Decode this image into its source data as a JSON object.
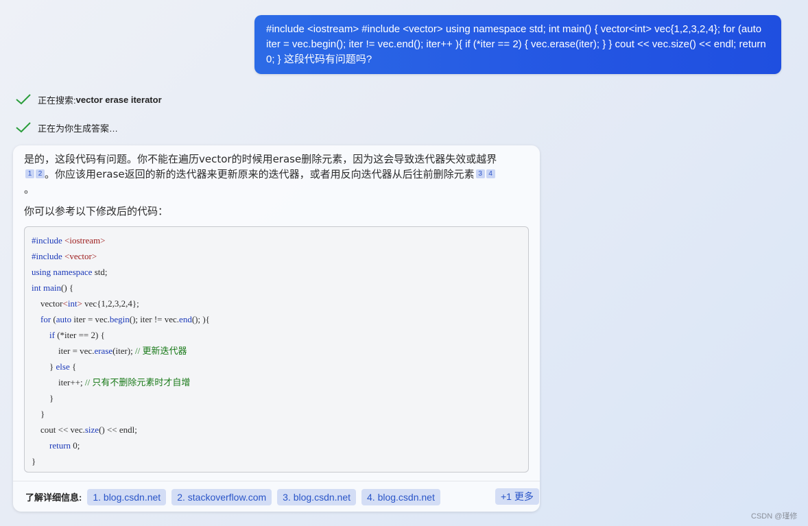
{
  "user_message": "#include <iostream> #include <vector> using namespace std; int main() { vector<int> vec{1,2,3,2,4}; for (auto iter = vec.begin(); iter != vec.end(); iter++ ){ if (*iter == 2) { vec.erase(iter); } } cout << vec.size() << endl; return 0; } 这段代码有问题吗?",
  "status": [
    {
      "prefix": "正在搜索: ",
      "bold": "vector erase iterator"
    },
    {
      "prefix": "正在为你生成答案…",
      "bold": ""
    }
  ],
  "answer": {
    "para1_a": "是的，这段代码有问题。你不能在遍历vector的时候用erase删除元素，因为这会导致迭代器失效或越界",
    "para1_b": "。你应该用erase返回的新的迭代器来更新原来的迭代器，或者用反向迭代器从后往前删除元素",
    "para1_c": "。",
    "cites": [
      "1",
      "2",
      "3",
      "4"
    ],
    "para2": "你可以参考以下修改后的代码："
  },
  "code": {
    "l1_pp": "#include",
    "l1_str": "<iostream>",
    "l2_pp": "#include",
    "l2_str": "<vector>",
    "l3_kw1": "using",
    "l3_kw2": "namespace",
    "l3_rest": " std;",
    "l4_kw": "int",
    "l4_fn": "main",
    "l4_rest": "() {",
    "l5_a": "vector",
    "l5_b": "<",
    "l5_kw": "int",
    "l5_c": ">",
    "l5_rest": " vec{1,2,3,2,4};",
    "l6_kw1": "for",
    "l6_a": " (",
    "l6_kw2": "auto",
    "l6_b": " iter = vec.",
    "l6_fn1": "begin",
    "l6_c": "(); iter != vec.",
    "l6_fn2": "end",
    "l6_d": "(); ){",
    "l7_kw": "if",
    "l7_rest": " (*iter == 2) {",
    "l8_a": "iter = vec.",
    "l8_fn": "erase",
    "l8_b": "(iter); ",
    "l8_cm": "// 更新迭代器",
    "l9_a": "} ",
    "l9_kw": "else",
    "l9_b": " {",
    "l10_a": "iter++; ",
    "l10_cm": "// 只有不删除元素时才自增",
    "l11": "}",
    "l12": "}",
    "l13_a": "cout << vec.",
    "l13_fn": "size",
    "l13_b": "() << endl;",
    "l14_kw": "return",
    "l14_rest": " 0;",
    "l15": "}"
  },
  "learn_more": {
    "label": "了解详细信息:",
    "links": [
      "1. blog.csdn.net",
      "2. stackoverflow.com",
      "3. blog.csdn.net",
      "4. blog.csdn.net"
    ],
    "more": "+1 更多"
  },
  "watermark": "CSDN @瑾修",
  "colors": {
    "accent": "#2456e3",
    "check": "#2a9d3a",
    "chip_bg": "#d3ddf5",
    "chip_text": "#2a55c8"
  }
}
